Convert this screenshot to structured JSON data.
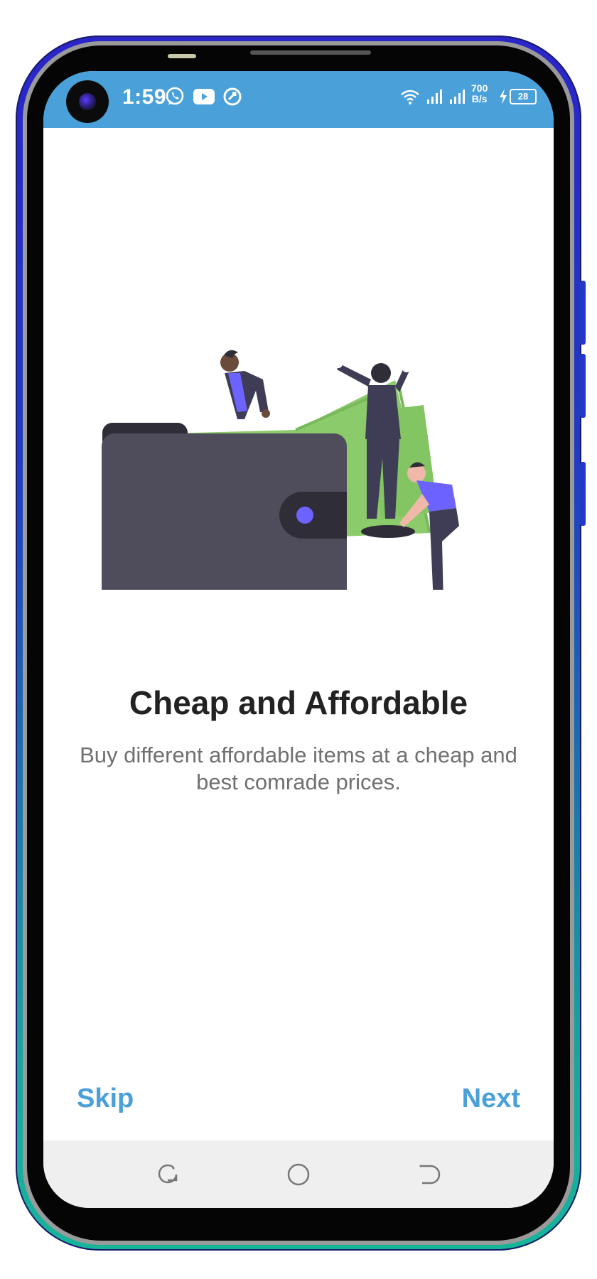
{
  "status_bar": {
    "time": "1:59",
    "icons": [
      "whatsapp-icon",
      "youtube-icon",
      "vpn-icon",
      "wifi-icon",
      "signal-icon",
      "signal-icon",
      "charging-icon"
    ],
    "net_speed_value": "700",
    "net_speed_unit": "B/s",
    "battery_level": "28",
    "bg_color": "#4aa0d9"
  },
  "onboarding": {
    "title": "Cheap and Affordable",
    "description": "Buy different affordable items at a cheap and best comrade prices."
  },
  "actions": {
    "skip_label": "Skip",
    "next_label": "Next",
    "accent_color": "#4aa0d9"
  },
  "nav_bar": {
    "buttons": [
      "recent-apps-icon",
      "home-icon",
      "back-icon"
    ]
  },
  "colors": {
    "wallet": "#4f4c5c",
    "money": "#8bcb6b",
    "purple": "#6c63ff"
  }
}
